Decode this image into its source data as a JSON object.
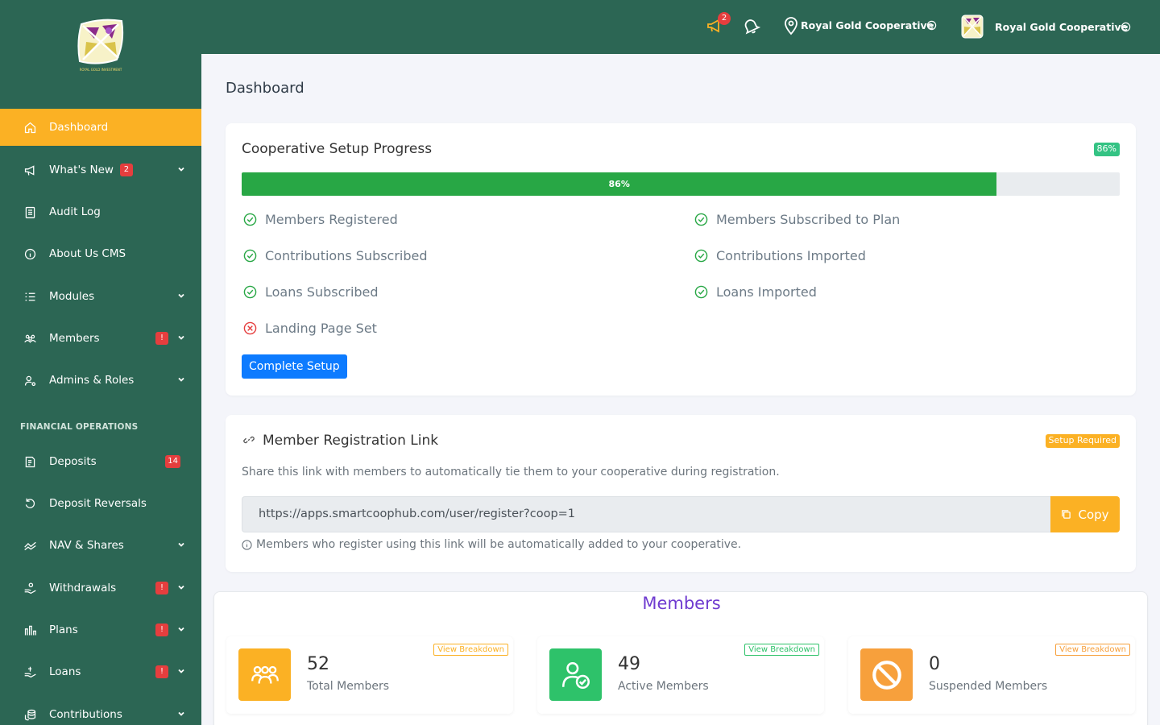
{
  "sidebar": {
    "logo_text": "ROYAL GOLD INVESTMENT",
    "items": [
      {
        "label": "Dashboard"
      },
      {
        "label": "What's New",
        "badge": "2"
      },
      {
        "label": "Audit Log"
      },
      {
        "label": "About Us CMS"
      },
      {
        "label": "Modules"
      },
      {
        "label": "Members",
        "badge": "!"
      },
      {
        "label": "Admins & Roles"
      },
      {
        "label": "Deposits",
        "badge": "14"
      },
      {
        "label": "Deposit Reversals"
      },
      {
        "label": "NAV & Shares"
      },
      {
        "label": "Withdrawals",
        "badge": "!"
      },
      {
        "label": "Plans",
        "badge": "!"
      },
      {
        "label": "Loans",
        "badge": "!"
      },
      {
        "label": "Contributions"
      }
    ],
    "section_financial": "FINANCIAL OPERATIONS"
  },
  "topbar": {
    "announcements_badge": "2",
    "location_label": "Royal Gold Cooperative",
    "profile_label": "Royal Gold Cooperative"
  },
  "page": {
    "title": "Dashboard"
  },
  "setup": {
    "title": "Cooperative Setup Progress",
    "percent_pill": "86%",
    "progress_label": "86%",
    "progress_value": 0.86,
    "items": [
      {
        "label": "Members Registered",
        "done": true
      },
      {
        "label": "Members Subscribed to Plan",
        "done": true
      },
      {
        "label": "Contributions Subscribed",
        "done": true
      },
      {
        "label": "Contributions Imported",
        "done": true
      },
      {
        "label": "Loans Subscribed",
        "done": true
      },
      {
        "label": "Loans Imported",
        "done": true
      },
      {
        "label": "Landing Page Set",
        "done": false
      }
    ],
    "button": "Complete Setup"
  },
  "registration": {
    "title": "Member Registration Link",
    "status_pill": "Setup Required",
    "description": "Share this link with members to automatically tie them to your cooperative during registration.",
    "link_value": "https://apps.smartcoophub.com/user/register?coop=1",
    "copy_label": "Copy",
    "hint": "Members who register using this link will be automatically added to your cooperative."
  },
  "members": {
    "title": "Members",
    "stats": [
      {
        "value": "52",
        "label": "Total Members",
        "breakdown": "View Breakdown",
        "color": "#fbb124",
        "icon": "users-group-icon"
      },
      {
        "value": "49",
        "label": "Active Members",
        "breakdown": "View Breakdown",
        "color": "#2ec26a",
        "icon": "user-check-icon"
      },
      {
        "value": "0",
        "label": "Suspended Members",
        "breakdown": "View Breakdown",
        "color": "#f7a03c",
        "icon": "ban-icon"
      }
    ]
  },
  "colors": {
    "sidebar_bg": "#2c6654",
    "active_item": "#fbb124",
    "progress_fill": "#28a745",
    "primary_button": "#0d7bff",
    "members_title": "#6f3bd0"
  }
}
